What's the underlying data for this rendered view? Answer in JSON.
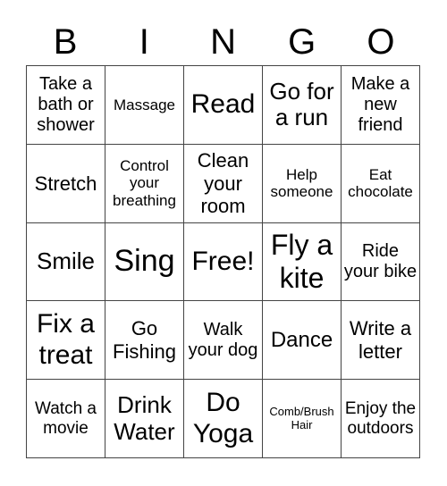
{
  "header": [
    "B",
    "I",
    "N",
    "G",
    "O"
  ],
  "cells": [
    "Take a bath or shower",
    "Massage",
    "Read",
    "Go for a run",
    "Make a new friend",
    "Stretch",
    "Control your breathing",
    "Clean your room",
    "Help someone",
    "Eat chocolate",
    "Smile",
    "Sing",
    "Free!",
    "Fly a kite",
    "Ride your bike",
    "Fix a treat",
    "Go Fishing",
    "Walk your dog",
    "Dance",
    "Write a letter",
    "Watch a movie",
    "Drink Water",
    "Do Yoga",
    "Comb/Brush Hair",
    "Enjoy the outdoors"
  ]
}
